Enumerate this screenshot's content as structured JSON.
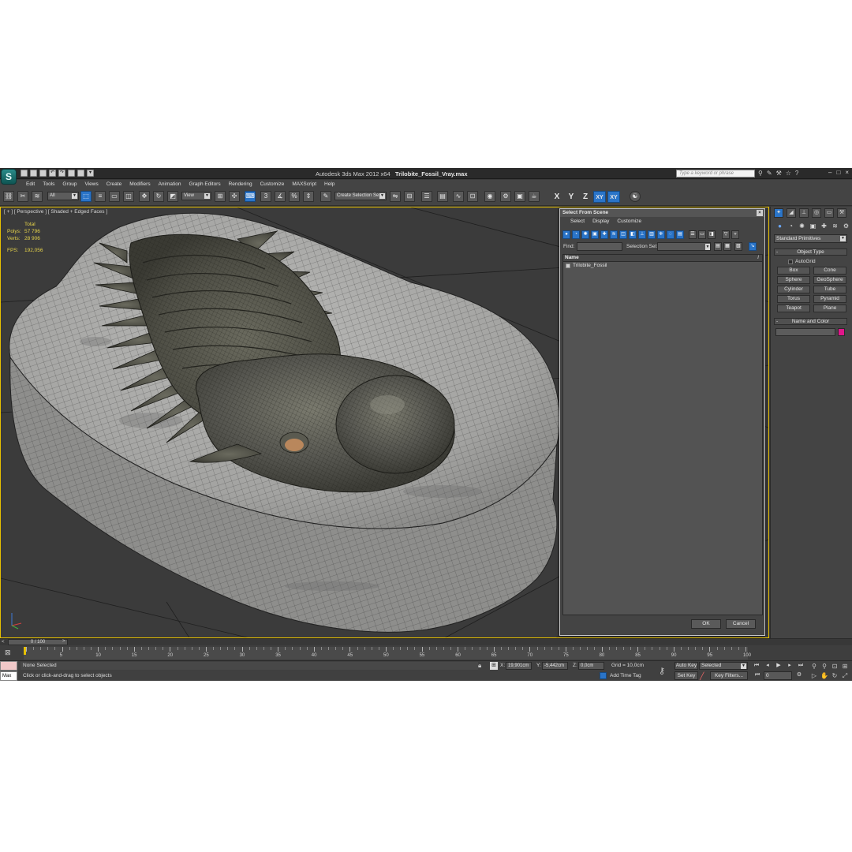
{
  "window": {
    "app_name": "Autodesk 3ds Max  2012 x64",
    "file_name": "Trilobite_Fossil_Vray.max",
    "search_placeholder": "Type a keyword or phrase"
  },
  "menu": [
    "Edit",
    "Tools",
    "Group",
    "Views",
    "Create",
    "Modifiers",
    "Animation",
    "Graph Editors",
    "Rendering",
    "Customize",
    "MAXScript",
    "Help"
  ],
  "toolbar": {
    "filter_value": "All",
    "ref_coord_value": "View",
    "named_selection_value": "Create Selection Se",
    "axis_buttons": [
      "X",
      "Y",
      "Z",
      "XY",
      "XY"
    ]
  },
  "viewport": {
    "label": "[ + ] [ Perspective ] [ Shaded + Edged Faces ]",
    "stats": {
      "total_label": "Total",
      "polys_label": "Polys:",
      "polys_value": "57 796",
      "verts_label": "Verts:",
      "verts_value": "28 906",
      "fps_label": "FPS:",
      "fps_value": "192,056"
    }
  },
  "command_panel": {
    "category": "Standard Primitives",
    "object_type_title": "Object Type",
    "autogrid_label": "AutoGrid",
    "primitives": [
      "Box",
      "Cone",
      "Sphere",
      "GeoSphere",
      "Cylinder",
      "Tube",
      "Torus",
      "Pyramid",
      "Teapot",
      "Plane"
    ],
    "name_color_title": "Name and Color",
    "object_color": "#e0168a"
  },
  "dialog": {
    "title": "Select From Scene",
    "menu": [
      "Select",
      "Display",
      "Customize"
    ],
    "find_label": "Find:",
    "selection_set_label": "Selection Set:",
    "list_header": "Name",
    "items": [
      "Trilobite_Fossil"
    ],
    "ok_label": "OK",
    "cancel_label": "Cancel"
  },
  "timeline": {
    "frame_display": "0 / 100",
    "ticks": [
      "5",
      "10",
      "15",
      "20",
      "25",
      "30",
      "35",
      "40",
      "45",
      "50",
      "55",
      "60",
      "65",
      "70",
      "75",
      "80",
      "85",
      "90",
      "95",
      "100"
    ]
  },
  "status": {
    "maxscript_label": "Max",
    "selection": "None Selected",
    "prompt": "Click or click-and-drag to select objects",
    "x_label": "X:",
    "x_value": "19,901cm",
    "y_label": "Y:",
    "y_value": "-5,442cm",
    "z_label": "Z:",
    "z_value": "0,0cm",
    "grid": "Grid = 10,0cm",
    "add_time_tag": "Add Time Tag",
    "auto_key": "Auto Key",
    "set_key": "Set Key",
    "selected_drop": "Selected",
    "key_filters": "Key Filters...",
    "current_frame": "0"
  }
}
